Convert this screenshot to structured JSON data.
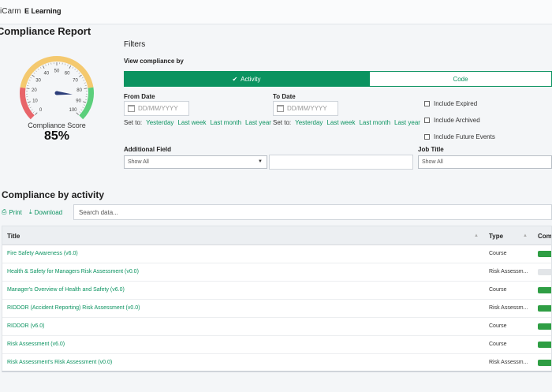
{
  "header": {
    "brand": "iCarm",
    "brand_sub": "E Learning"
  },
  "page_title": "Compliance Report",
  "gauge": {
    "value": 85,
    "min": 0,
    "max": 100,
    "ticks": [
      "0",
      "10",
      "20",
      "30",
      "40",
      "50",
      "60",
      "70",
      "80",
      "90",
      "100"
    ],
    "label": "Compliance Score",
    "value_text": "85%",
    "colors": {
      "low": "#e8656a",
      "mid": "#f4c96f",
      "high": "#5ccf7c",
      "needle": "#2c3e7a"
    }
  },
  "filters": {
    "title": "Filters",
    "view_by_label": "View compliance by",
    "toggle": {
      "active": "Activity",
      "inactive": "Code"
    },
    "from_date": {
      "label": "From Date",
      "placeholder": "DD/MM/YYYY"
    },
    "to_date": {
      "label": "To Date",
      "placeholder": "DD/MM/YYYY"
    },
    "set_to": {
      "prefix": "Set to:",
      "options": [
        "Yesterday",
        "Last week",
        "Last month",
        "Last year"
      ]
    },
    "checkboxes": [
      "Include Expired",
      "Include Archived",
      "Include Future Events"
    ],
    "additional_field": {
      "label": "Additional Field",
      "value": "Show All"
    },
    "job_title": {
      "label": "Job Title",
      "value": "Show All"
    }
  },
  "activity": {
    "section_title": "Compliance by activity",
    "print_label": "Print",
    "download_label": "Download",
    "search_placeholder": "Search data...",
    "columns": [
      "Title",
      "Type",
      "Comp"
    ],
    "rows": [
      {
        "title": "Fire Safety Awareness (v6.0)",
        "type": "Course",
        "status": "complete"
      },
      {
        "title": "Health & Safety for Managers Risk Assessment (v0.0)",
        "type": "Risk Assessm...",
        "status": "none"
      },
      {
        "title": "Manager's Overview of Health and Safety (v6.0)",
        "type": "Course",
        "status": "complete"
      },
      {
        "title": "RIDDOR (Accident Reporting) Risk Assessment (v0.0)",
        "type": "Risk Assessm...",
        "status": "complete"
      },
      {
        "title": "RIDDOR (v6.0)",
        "type": "Course",
        "status": "complete"
      },
      {
        "title": "Risk Assessment (v6.0)",
        "type": "Course",
        "status": "complete"
      },
      {
        "title": "Risk Assessment's Risk Assessment (v0.0)",
        "type": "Risk Assessm...",
        "status": "complete"
      }
    ],
    "status_colors": {
      "complete": "#2f9e44",
      "none": "#e2e5e8"
    }
  },
  "accent_color": "#0b9360"
}
